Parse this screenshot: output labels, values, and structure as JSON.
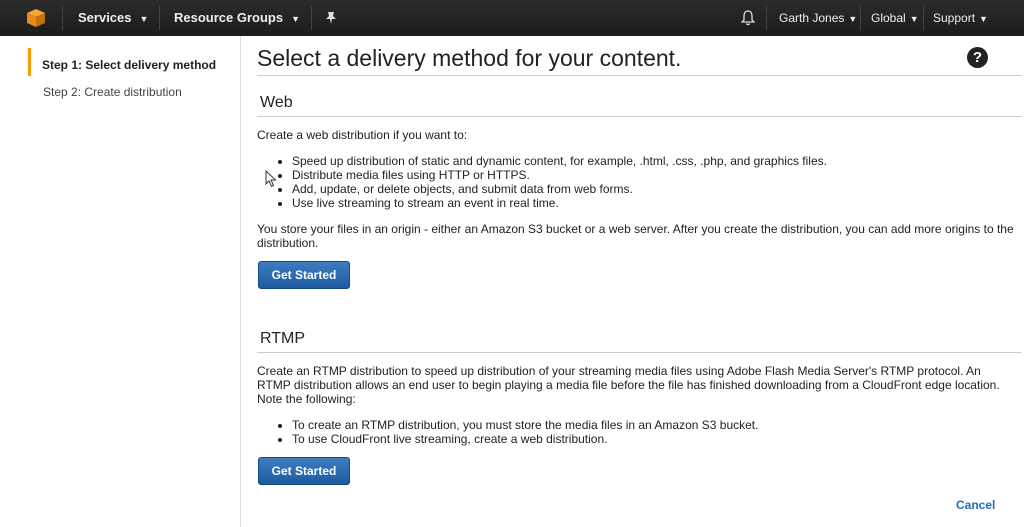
{
  "header": {
    "services": "Services",
    "resource_groups": "Resource Groups",
    "user": "Garth Jones",
    "region": "Global",
    "support": "Support"
  },
  "sidebar": {
    "steps": [
      {
        "label": "Step 1: Select delivery method",
        "active": true
      },
      {
        "label": "Step 2: Create distribution",
        "active": false
      }
    ]
  },
  "main": {
    "title": "Select a delivery method for your content.",
    "help": "?",
    "web": {
      "heading": "Web",
      "intro": "Create a web distribution if you want to:",
      "bullets": [
        "Speed up distribution of static and dynamic content, for example, .html, .css, .php, and graphics files.",
        "Distribute media files using HTTP or HTTPS.",
        "Add, update, or delete objects, and submit data from web forms.",
        "Use live streaming to stream an event in real time."
      ],
      "note": "You store your files in an origin - either an Amazon S3 bucket or a web server. After you create the distribution, you can add more origins to the distribution.",
      "button": "Get Started"
    },
    "rtmp": {
      "heading": "RTMP",
      "intro": "Create an RTMP distribution to speed up distribution of your streaming media files using Adobe Flash Media Server's RTMP protocol. An RTMP distribution allows an end user to begin playing a media file before the file has finished downloading from a CloudFront edge location. Note the following:",
      "bullets": [
        "To create an RTMP distribution, you must store the media files in an Amazon S3 bucket.",
        "To use CloudFront live streaming, create a web distribution."
      ],
      "button": "Get Started"
    },
    "cancel": "Cancel"
  }
}
